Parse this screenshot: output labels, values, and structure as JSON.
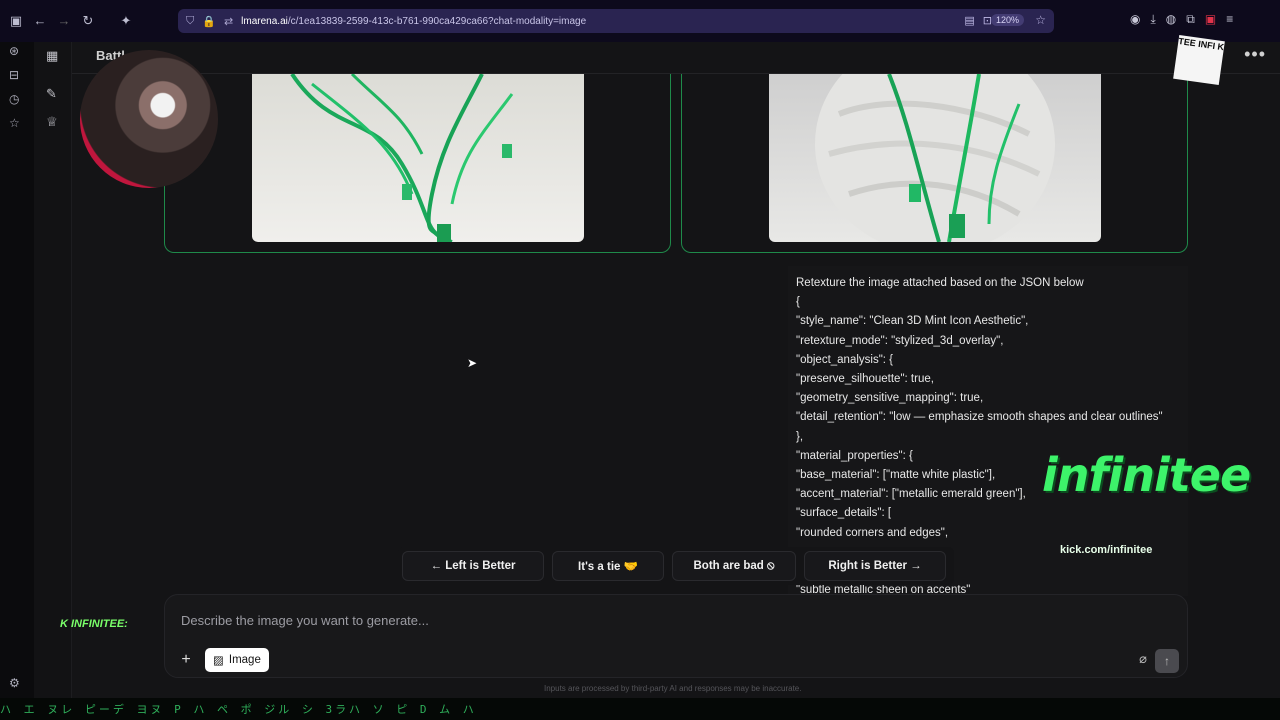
{
  "browser": {
    "url_host": "lmarena.ai",
    "url_path": "/c/1ea13839-2599-413c-b761-990ca429ca66?chat-modality=image",
    "zoom": "120%"
  },
  "header": {
    "title": "Battl"
  },
  "prompt": {
    "lines": [
      "Retexture the image attached based on the JSON below",
      "{",
      "\"style_name\": \"Clean 3D Mint Icon Aesthetic\",",
      "\"retexture_mode\": \"stylized_3d_overlay\",",
      "\"object_analysis\": {",
      "\"preserve_silhouette\": true,",
      "\"geometry_sensitive_mapping\": true,",
      "\"detail_retention\": \"low — emphasize smooth shapes and clear outlines\"",
      "},",
      "\"material_properties\": {",
      "\"base_material\": [\"matte white plastic\"],",
      "\"accent_material\": [\"metallic emerald green\"],",
      "\"surface_details\": [",
      "\"rounded corners and edges\",",
      "",
      "",
      "\"subtle metallic sheen on accents\""
    ]
  },
  "vote": {
    "left": "← Left is Better",
    "tie": "It's a tie 🤝",
    "both_bad": "Both are bad ⦸",
    "right": "Right is Better →"
  },
  "composer": {
    "placeholder": "Describe the image you want to generate...",
    "image_chip": "Image",
    "plus": "+"
  },
  "disclaimer": "Inputs are processed by third-party AI and responses may be inaccurate.",
  "overlay": {
    "logo": "infinitee",
    "logo_url": "kick.com/infinitee",
    "badge": "K INFINITEE:",
    "corner_logo": "TEE INFI K"
  },
  "matrix_text": "ハ  エ  ヌレ  ピーデ             ヨヌ   P   ハ  ペ        ポ      ジル  シ         3ラハ   ソ    ピ    D    ム  ハ"
}
